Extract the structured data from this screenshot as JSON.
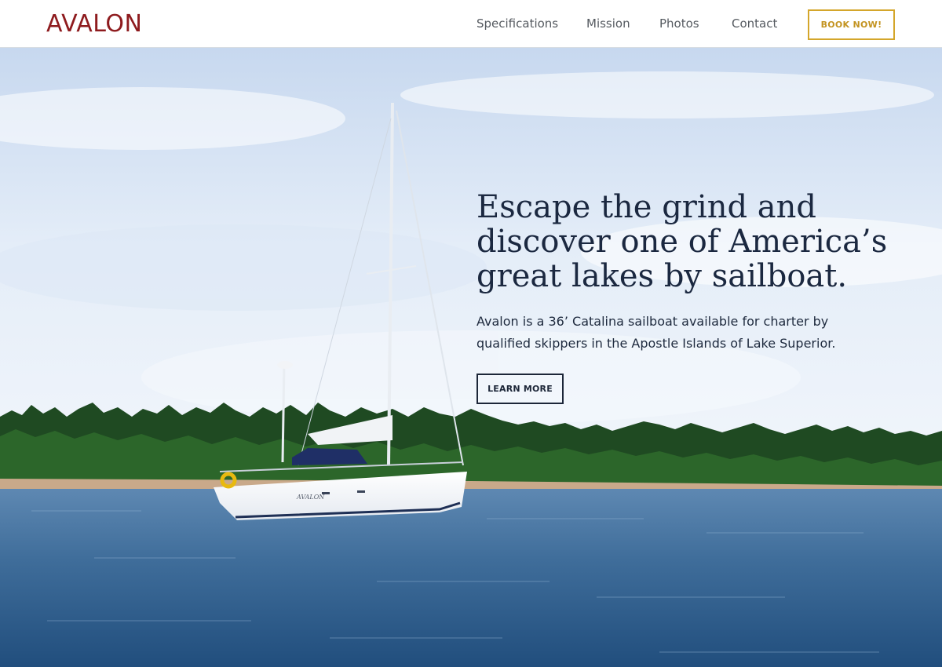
{
  "brand": {
    "logo_text": "AVALON"
  },
  "nav": {
    "items": [
      {
        "label": "Specifications"
      },
      {
        "label": "Mission"
      },
      {
        "label": "Photos"
      },
      {
        "label": "Contact"
      }
    ],
    "cta_label": "BOOK NOW!"
  },
  "hero": {
    "headline": "Escape the grind and discover one of America’s great lakes by sailboat.",
    "subtext": "Avalon is a 36’ Catalina sailboat available for charter by qualified skippers in the Apostle Islands of Lake Superior.",
    "cta_label": "LEARN MORE",
    "boat_name": "AVALON"
  },
  "colors": {
    "brand_red": "#8e1b1e",
    "cta_gold": "#d4a62b",
    "headline_navy": "#1b2840"
  }
}
